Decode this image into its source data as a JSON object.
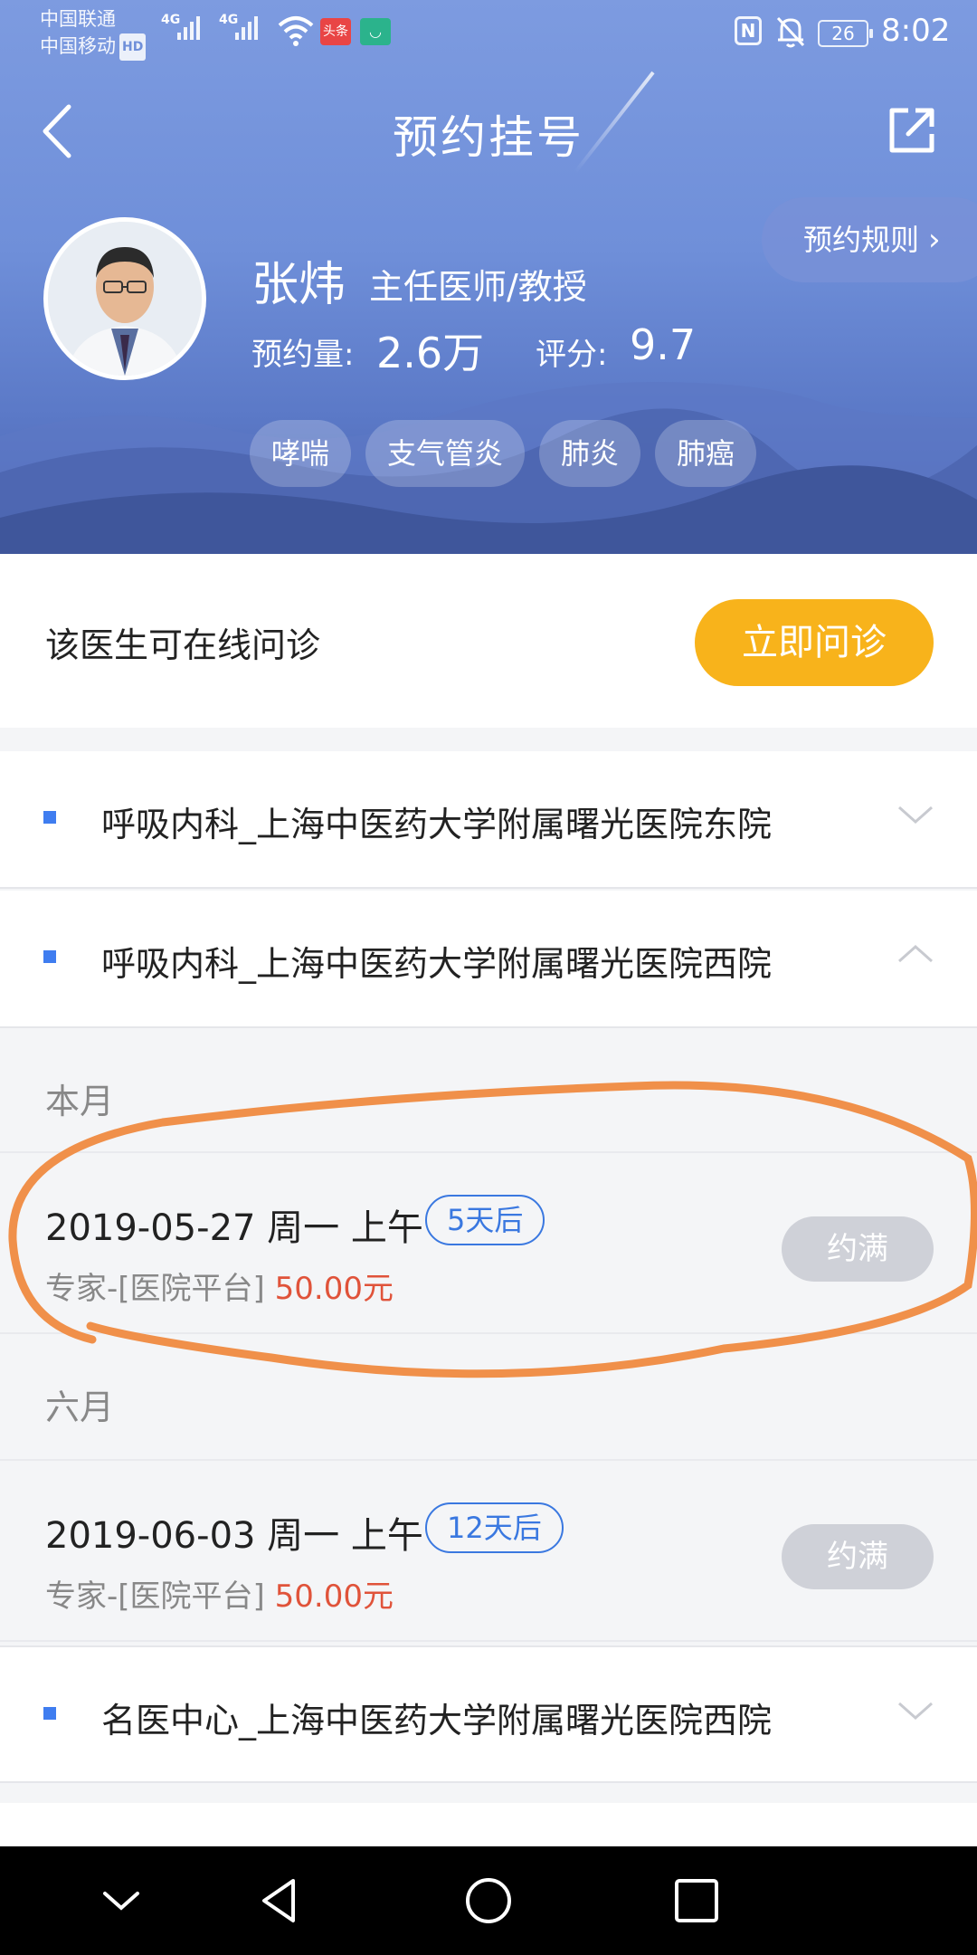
{
  "status_bar": {
    "carrier_1": "中国联通",
    "carrier_2": "中国移动",
    "hd_badge": "HD",
    "network_1": "4G",
    "network_2": "4G",
    "toutiao_badge": "头条",
    "battery": "26",
    "time": "8:02"
  },
  "header": {
    "title": "预约挂号",
    "rules_label": "预约规则"
  },
  "doctor": {
    "name": "张炜",
    "title": "主任医师/教授",
    "appointments_label": "预约量:",
    "appointments_value": "2.6万",
    "rating_label": "评分:",
    "rating_value": "9.7",
    "tags": [
      "哮喘",
      "支气管炎",
      "肺炎",
      "肺癌"
    ]
  },
  "consult": {
    "text": "该医生可在线问诊",
    "button": "立即问诊"
  },
  "departments": [
    {
      "name": "呼吸内科_上海中医药大学附属曙光医院东院",
      "expanded": false
    },
    {
      "name": "呼吸内科_上海中医药大学附属曙光医院西院",
      "expanded": true
    },
    {
      "name": "名医中心_上海中医药大学附属曙光医院西院",
      "expanded": false
    }
  ],
  "schedule": {
    "month_1": "本月",
    "month_2": "六月",
    "slots": [
      {
        "date": "2019-05-27 周一 上午",
        "days_ahead": "5天后",
        "type": "专家-[医院平台]",
        "price": "50.00元",
        "status": "约满"
      },
      {
        "date": "2019-06-03 周一 上午",
        "days_ahead": "12天后",
        "type": "专家-[医院平台]",
        "price": "50.00元",
        "status": "约满"
      }
    ]
  },
  "colors": {
    "header_blue": "#6f8fd9",
    "consult_button": "#f8b31b",
    "accent_blue": "#3a78e0",
    "price_red": "#e0533a",
    "full_button": "#cfd1d8",
    "annotation_orange": "#f0904a"
  }
}
